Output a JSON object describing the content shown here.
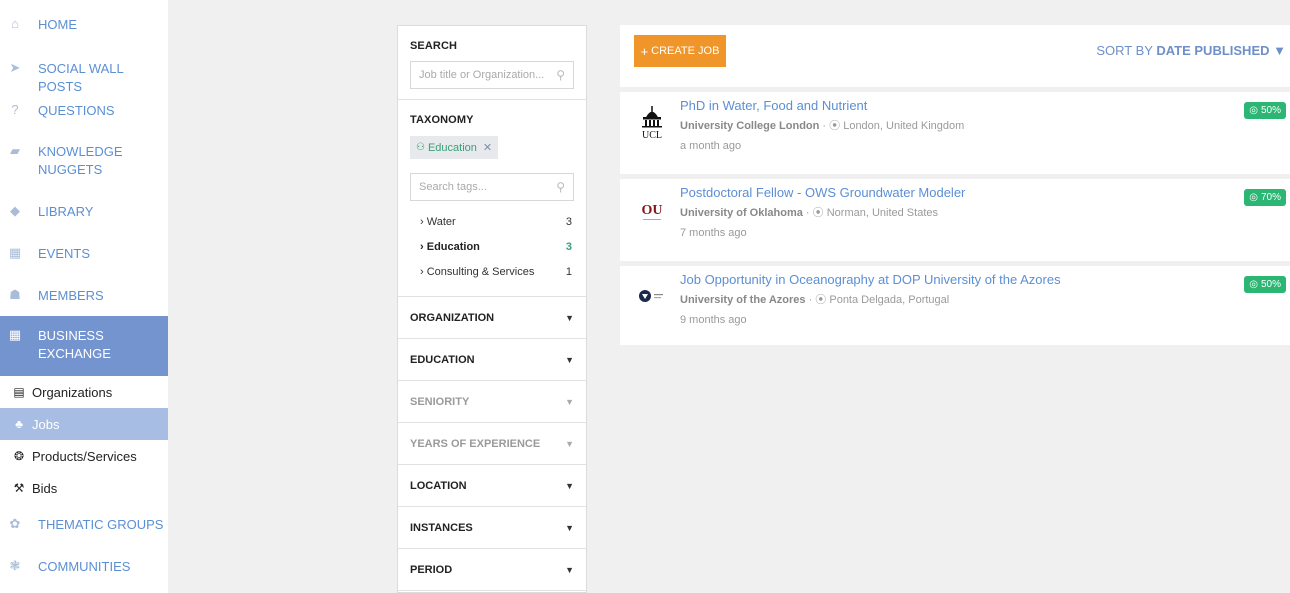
{
  "sidebar": {
    "items": [
      {
        "label": "HOME",
        "icon": "home-icon",
        "glyph": "⌂"
      },
      {
        "label": "SOCIAL WALL POSTS",
        "icon": "send-icon",
        "glyph": "➤"
      },
      {
        "label": "QUESTIONS",
        "icon": "question-icon",
        "glyph": "?"
      },
      {
        "label": "KNOWLEDGE NUGGETS",
        "icon": "nugget-icon",
        "glyph": "▰"
      },
      {
        "label": "LIBRARY",
        "icon": "library-icon",
        "glyph": "◆"
      },
      {
        "label": "EVENTS",
        "icon": "calendar-icon",
        "glyph": "▦"
      },
      {
        "label": "MEMBERS",
        "icon": "members-icon",
        "glyph": "☗"
      },
      {
        "label": "BUSINESS EXCHANGE",
        "icon": "business-icon",
        "glyph": "▦"
      }
    ],
    "sub_items": [
      {
        "label": "Organizations",
        "icon": "building-icon",
        "glyph": "▤"
      },
      {
        "label": "Jobs",
        "icon": "people-icon",
        "glyph": "♣"
      },
      {
        "label": "Products/Services",
        "icon": "cube-icon",
        "glyph": "❂"
      },
      {
        "label": "Bids",
        "icon": "gavel-icon",
        "glyph": "⚒"
      }
    ],
    "bottom_items": [
      {
        "label": "THEMATIC GROUPS",
        "icon": "groups-icon",
        "glyph": "✿"
      },
      {
        "label": "COMMUNITIES",
        "icon": "communities-icon",
        "glyph": "❃"
      }
    ]
  },
  "filters": {
    "search_title": "SEARCH",
    "search_placeholder": "Job title or Organization...",
    "taxonomy_title": "TAXONOMY",
    "chip_label": "Education",
    "tags_placeholder": "Search tags...",
    "tags": [
      {
        "label": "Water",
        "count": "3"
      },
      {
        "label": "Education",
        "count": "3"
      },
      {
        "label": "Consulting & Services",
        "count": "1"
      }
    ],
    "sections": [
      {
        "label": "ORGANIZATION"
      },
      {
        "label": "EDUCATION"
      },
      {
        "label": "SENIORITY"
      },
      {
        "label": "YEARS OF EXPERIENCE"
      },
      {
        "label": "LOCATION"
      },
      {
        "label": "INSTANCES"
      },
      {
        "label": "PERIOD"
      }
    ]
  },
  "main": {
    "create_label": "CREATE JOB",
    "sort_prefix": "SORT BY",
    "sort_value": "DATE PUBLISHED",
    "jobs": [
      {
        "title": "PhD in Water, Food and Nutrient",
        "org": "University College London",
        "location": "London, United Kingdom",
        "time": "a month ago",
        "match": "50%",
        "logo_text": "UCL"
      },
      {
        "title": "Postdoctoral Fellow - OWS Groundwater Modeler",
        "org": "University of Oklahoma",
        "location": "Norman, United States",
        "time": "7 months ago",
        "match": "70%",
        "logo_text": "OU"
      },
      {
        "title": "Job Opportunity in Oceanography at DOP University of the Azores",
        "org": "University of the Azores",
        "location": "Ponta Delgada, Portugal",
        "time": "9 months ago",
        "match": "50%",
        "logo_text": ""
      }
    ]
  },
  "colors": {
    "accent_blue": "#5b8fd4",
    "active_nav": "#7394cf",
    "create_orange": "#f0952a",
    "match_green": "#2bb673"
  }
}
